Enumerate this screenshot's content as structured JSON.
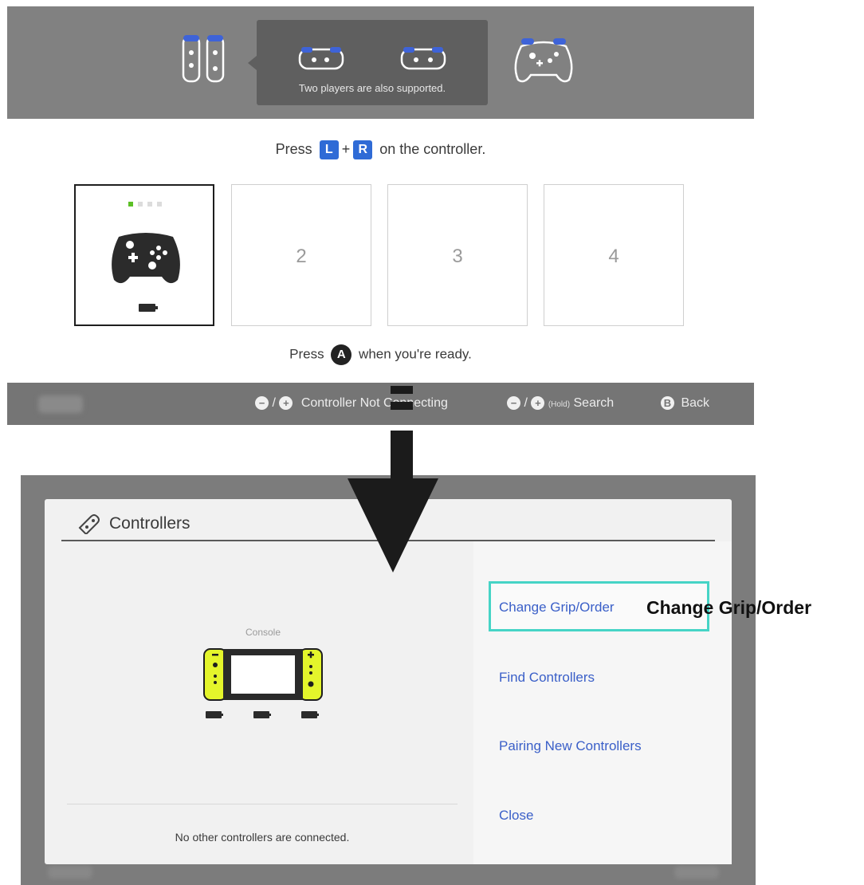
{
  "top": {
    "tooltip_text": "Two players are also supported.",
    "instruction_prefix": "Press",
    "key_l": "L",
    "key_plus": "+",
    "key_r": "R",
    "instruction_suffix": "on the controller.",
    "slots": [
      {
        "label": "",
        "state": "connected",
        "player_led": 1
      },
      {
        "label": "2"
      },
      {
        "label": "3"
      },
      {
        "label": "4"
      }
    ],
    "ready_prefix": "Press",
    "ready_button": "A",
    "ready_suffix": "when you're ready.",
    "footer": {
      "not_connecting_label": "Controller Not Connecting",
      "search_hold": "(Hold)",
      "search_label": "Search",
      "back_button": "B",
      "back_label": "Back",
      "minus": "−",
      "plus": "+",
      "slash": "/"
    }
  },
  "bottom": {
    "title": "Controllers",
    "console_label": "Console",
    "no_controllers_text": "No other controllers are connected.",
    "menu": [
      {
        "label": "Change Grip/Order",
        "selected": true
      },
      {
        "label": "Find Controllers",
        "selected": false
      },
      {
        "label": "Pairing New Controllers",
        "selected": false
      },
      {
        "label": "Close",
        "selected": false
      }
    ]
  },
  "annotation": "Change Grip/Order",
  "colors": {
    "accent_blue": "#2f6bd6",
    "menu_text": "#3a5fc8",
    "selection_border": "#46d4c6",
    "joycon_yellow": "#e4f52b",
    "led_green": "#5cc026"
  }
}
